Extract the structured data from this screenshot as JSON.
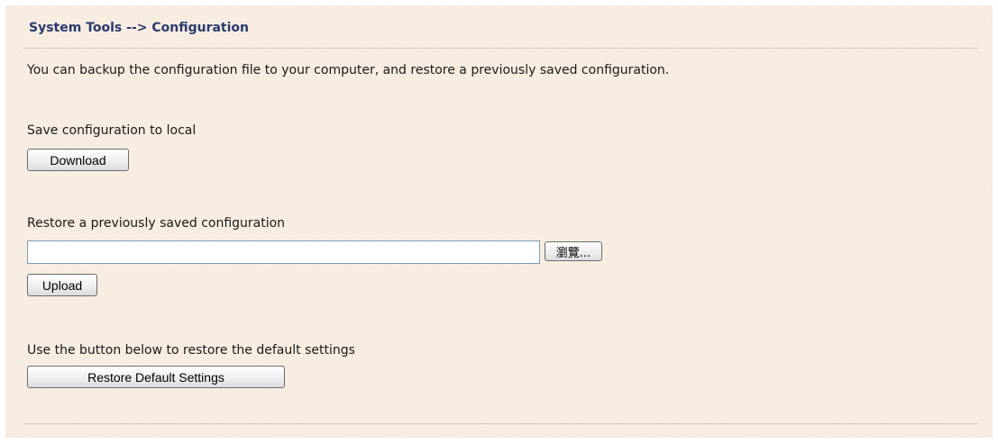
{
  "page": {
    "title": "System Tools --> Configuration",
    "intro": "You can backup the configuration file to your computer, and restore a previously saved configuration."
  },
  "save_section": {
    "label": "Save configuration to local",
    "download_button": "Download"
  },
  "restore_section": {
    "label": "Restore a previously saved configuration",
    "file_input_value": "",
    "browse_button": "瀏覽...",
    "upload_button": "Upload"
  },
  "default_section": {
    "label": "Use the button below to restore the default settings",
    "restore_button": "Restore Default Settings"
  },
  "colors": {
    "background": "#f7ecdf",
    "title": "#2a3a6e",
    "divider": "#d8cdc0"
  }
}
